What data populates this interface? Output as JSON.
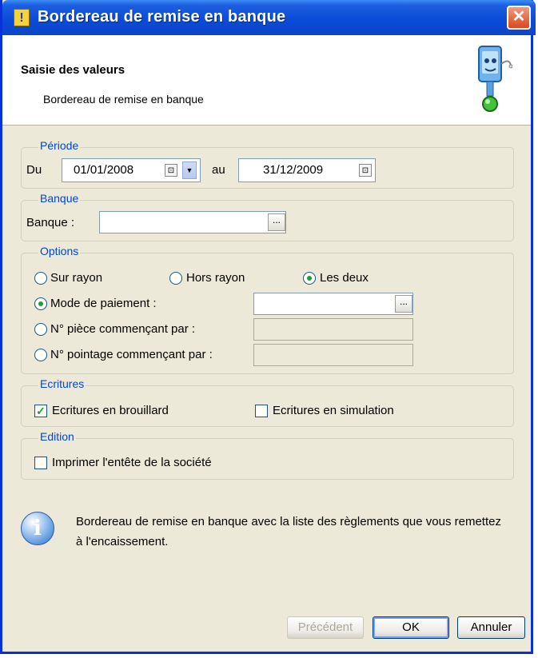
{
  "window": {
    "title": "Bordereau de remise en banque"
  },
  "header": {
    "title": "Saisie des valeurs",
    "subtitle": "Bordereau de remise en banque"
  },
  "periode": {
    "legend": "Période",
    "du_label": "Du",
    "du_value": "01/01/2008",
    "au_label": "au",
    "au_value": "31/12/2009"
  },
  "banque": {
    "legend": "Banque",
    "label": "Banque :",
    "value": "",
    "browse": "..."
  },
  "options": {
    "legend": "Options",
    "sur_rayon": "Sur rayon",
    "hors_rayon": "Hors rayon",
    "les_deux": "Les deux",
    "mode_paiement": "Mode de paiement :",
    "mode_paiement_value": "",
    "piece": "N° pièce commençant par :",
    "pointage": "N° pointage commençant par :",
    "browse": "..."
  },
  "ecritures": {
    "legend": "Ecritures",
    "brouillard": "Ecritures en brouillard",
    "simulation": "Ecritures en simulation"
  },
  "edition": {
    "legend": "Edition",
    "entete": "Imprimer l'entête de la société"
  },
  "info": {
    "text": "Bordereau de remise en banque avec la liste des règlements que vous remettez à l'encaissement."
  },
  "buttons": {
    "precedent": "Précédent",
    "ok": "OK",
    "annuler": "Annuler"
  }
}
